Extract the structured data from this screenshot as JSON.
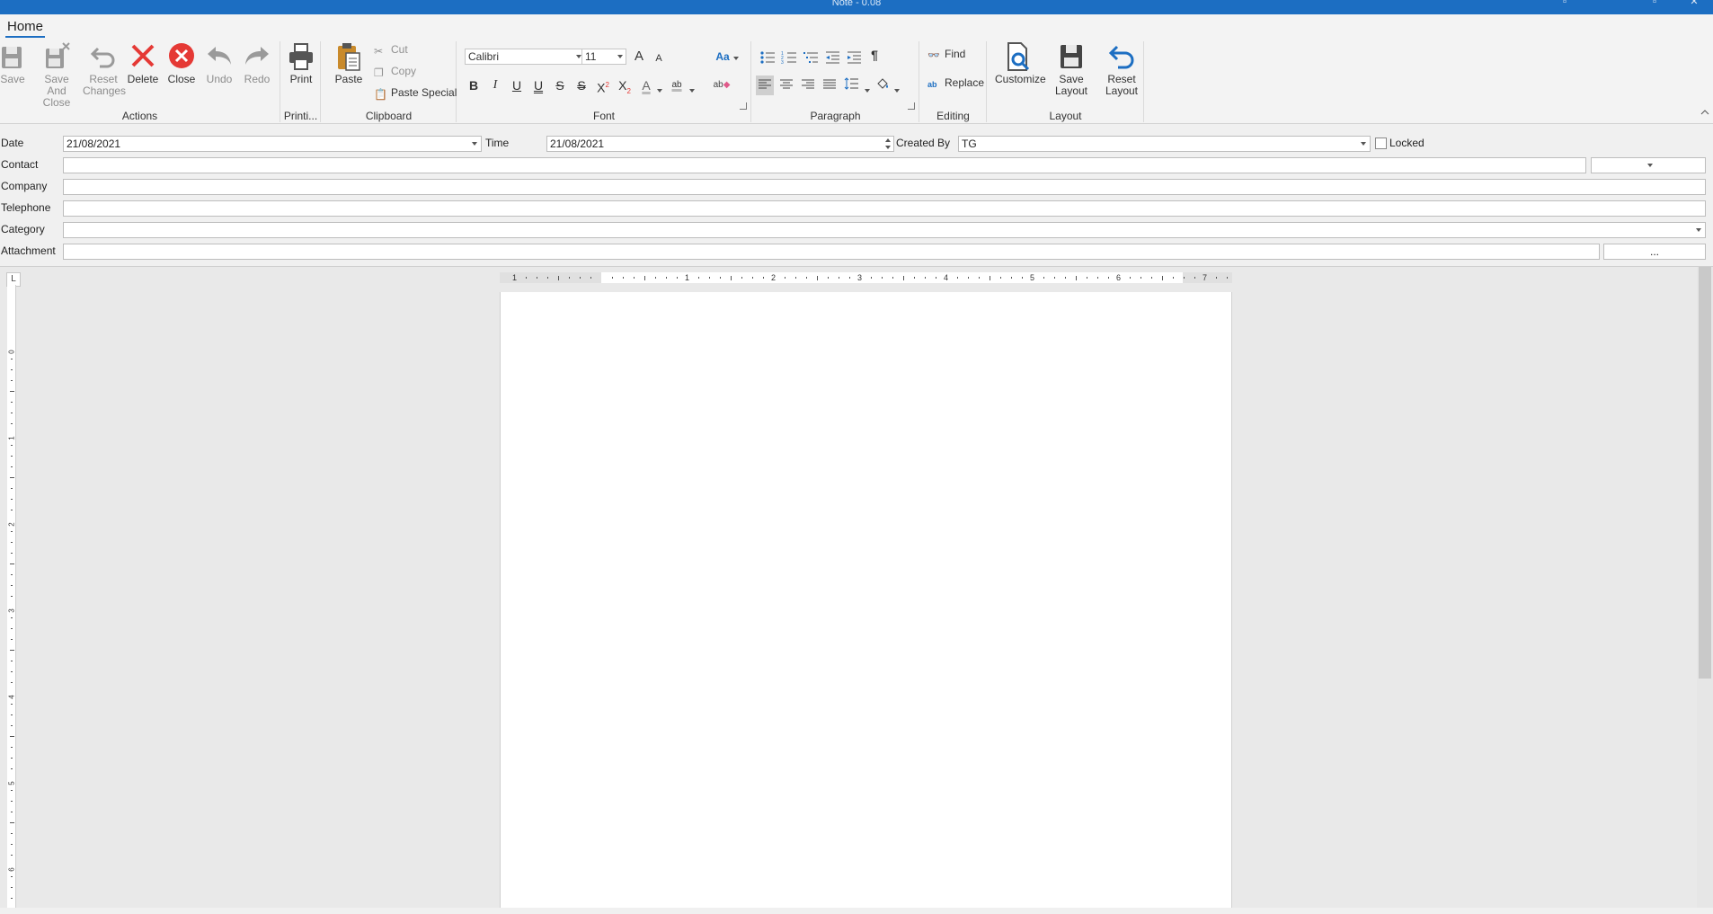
{
  "window": {
    "title": "Note - 0.08",
    "controls": [
      "minimize-icon",
      "maximize-icon",
      "close-icon"
    ]
  },
  "ribbon": {
    "tab": "Home",
    "groups": {
      "actions": {
        "label": "Actions",
        "save": "Save",
        "save_close": "Save And Close",
        "reset_changes": "Reset Changes",
        "delete": "Delete",
        "close": "Close",
        "undo": "Undo",
        "redo": "Redo"
      },
      "printing": {
        "label": "Printi...",
        "print": "Print"
      },
      "clipboard": {
        "label": "Clipboard",
        "paste": "Paste",
        "cut": "Cut",
        "copy": "Copy",
        "paste_special": "Paste Special"
      },
      "font": {
        "label": "Font",
        "font_name": "Calibri",
        "font_size": "11",
        "grow": "A",
        "shrink": "A",
        "change_case": "Aa",
        "bold": "B",
        "italic": "I",
        "underline": "U",
        "double_underline": "U",
        "strike": "S",
        "double_strike": "S",
        "superscript": "X",
        "subscript": "X",
        "font_color": "A",
        "highlight": "ab",
        "clear_format": "ab"
      },
      "paragraph": {
        "label": "Paragraph",
        "show_marks": "¶"
      },
      "editing": {
        "label": "Editing",
        "find": "Find",
        "replace": "Replace"
      },
      "layout": {
        "label": "Layout",
        "customize": "Customize",
        "save_layout": "Save Layout",
        "reset_layout": "Reset Layout"
      }
    }
  },
  "form": {
    "date": {
      "label": "Date",
      "value": "21/08/2021"
    },
    "time": {
      "label": "Time",
      "value": "21/08/2021"
    },
    "created_by": {
      "label": "Created By",
      "value": "TG"
    },
    "locked": {
      "label": "Locked",
      "checked": false
    },
    "contact": {
      "label": "Contact",
      "value": "",
      "type_value": ""
    },
    "company": {
      "label": "Company",
      "value": ""
    },
    "telephone": {
      "label": "Telephone",
      "value": ""
    },
    "category": {
      "label": "Category",
      "value": ""
    },
    "attachment": {
      "label": "Attachment",
      "value": "",
      "browse": "..."
    }
  },
  "editor": {
    "ruler_numbers": [
      "1",
      "1",
      "2",
      "3",
      "4",
      "5",
      "6",
      "7"
    ],
    "vruler_numbers": [
      "0",
      "1",
      "2",
      "3",
      "4",
      "5",
      "6"
    ],
    "tabstop": "L"
  },
  "colors": {
    "titlebar": "#1c6ec2",
    "accent": "#1c6ec2",
    "delete_red": "#e53935",
    "close_red": "#e53935"
  }
}
